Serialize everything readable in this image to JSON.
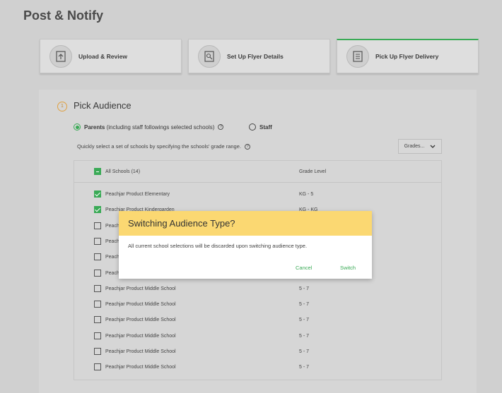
{
  "page": {
    "title": "Post & Notify"
  },
  "steps": [
    {
      "label": "Upload & Review",
      "icon": "upload-icon"
    },
    {
      "label": "Set Up Flyer Details",
      "icon": "search-document-icon"
    },
    {
      "label": "Pick Up Flyer Delivery",
      "icon": "list-document-icon",
      "active": true
    }
  ],
  "section": {
    "number": "1",
    "title": "Pick Audience"
  },
  "audience": {
    "parents_label": "Parents",
    "parents_note": "(including staff followings selected schools)",
    "staff_label": "Staff",
    "selected": "parents"
  },
  "hint": "Quickly select a set of schools by specifying the schools' grade range.",
  "grades_dropdown": {
    "label": "Grades...",
    "icon": "chevron-down-icon"
  },
  "table": {
    "header_name": "All Schools (14)",
    "header_grade": "Grade Level",
    "rows": [
      {
        "name": "Peachjar Product Elementary",
        "grade": "KG - 5",
        "checked": true
      },
      {
        "name": "Peachjar Product Kindergarden",
        "grade": "KG - KG",
        "checked": true
      },
      {
        "name": "Peachjar Product Middle School",
        "grade": "5 - 7",
        "checked": false
      },
      {
        "name": "Peachjar Product Middle School",
        "grade": "5 - 7",
        "checked": false
      },
      {
        "name": "Peachjar Product Middle School",
        "grade": "5 - 7",
        "checked": false
      },
      {
        "name": "Peachjar Product Middle School",
        "grade": "5 - 7",
        "checked": false
      },
      {
        "name": "Peachjar Product Middle School",
        "grade": "5 - 7",
        "checked": false
      },
      {
        "name": "Peachjar Product Middle School",
        "grade": "5 - 7",
        "checked": false
      },
      {
        "name": "Peachjar Product Middle School",
        "grade": "5 - 7",
        "checked": false
      },
      {
        "name": "Peachjar Product Middle School",
        "grade": "5 - 7",
        "checked": false
      },
      {
        "name": "Peachjar Product Middle School",
        "grade": "5 - 7",
        "checked": false
      },
      {
        "name": "Peachjar Product Middle School",
        "grade": "5 - 7",
        "checked": false
      }
    ]
  },
  "modal": {
    "title": "Switching Audience Type?",
    "message": "All current school selections will be discarded upon switching audience type.",
    "cancel_label": "Cancel",
    "switch_label": "Switch"
  },
  "colors": {
    "accent": "#3aaa56",
    "modal_header": "#fbd872",
    "step_number": "#e0a040"
  }
}
